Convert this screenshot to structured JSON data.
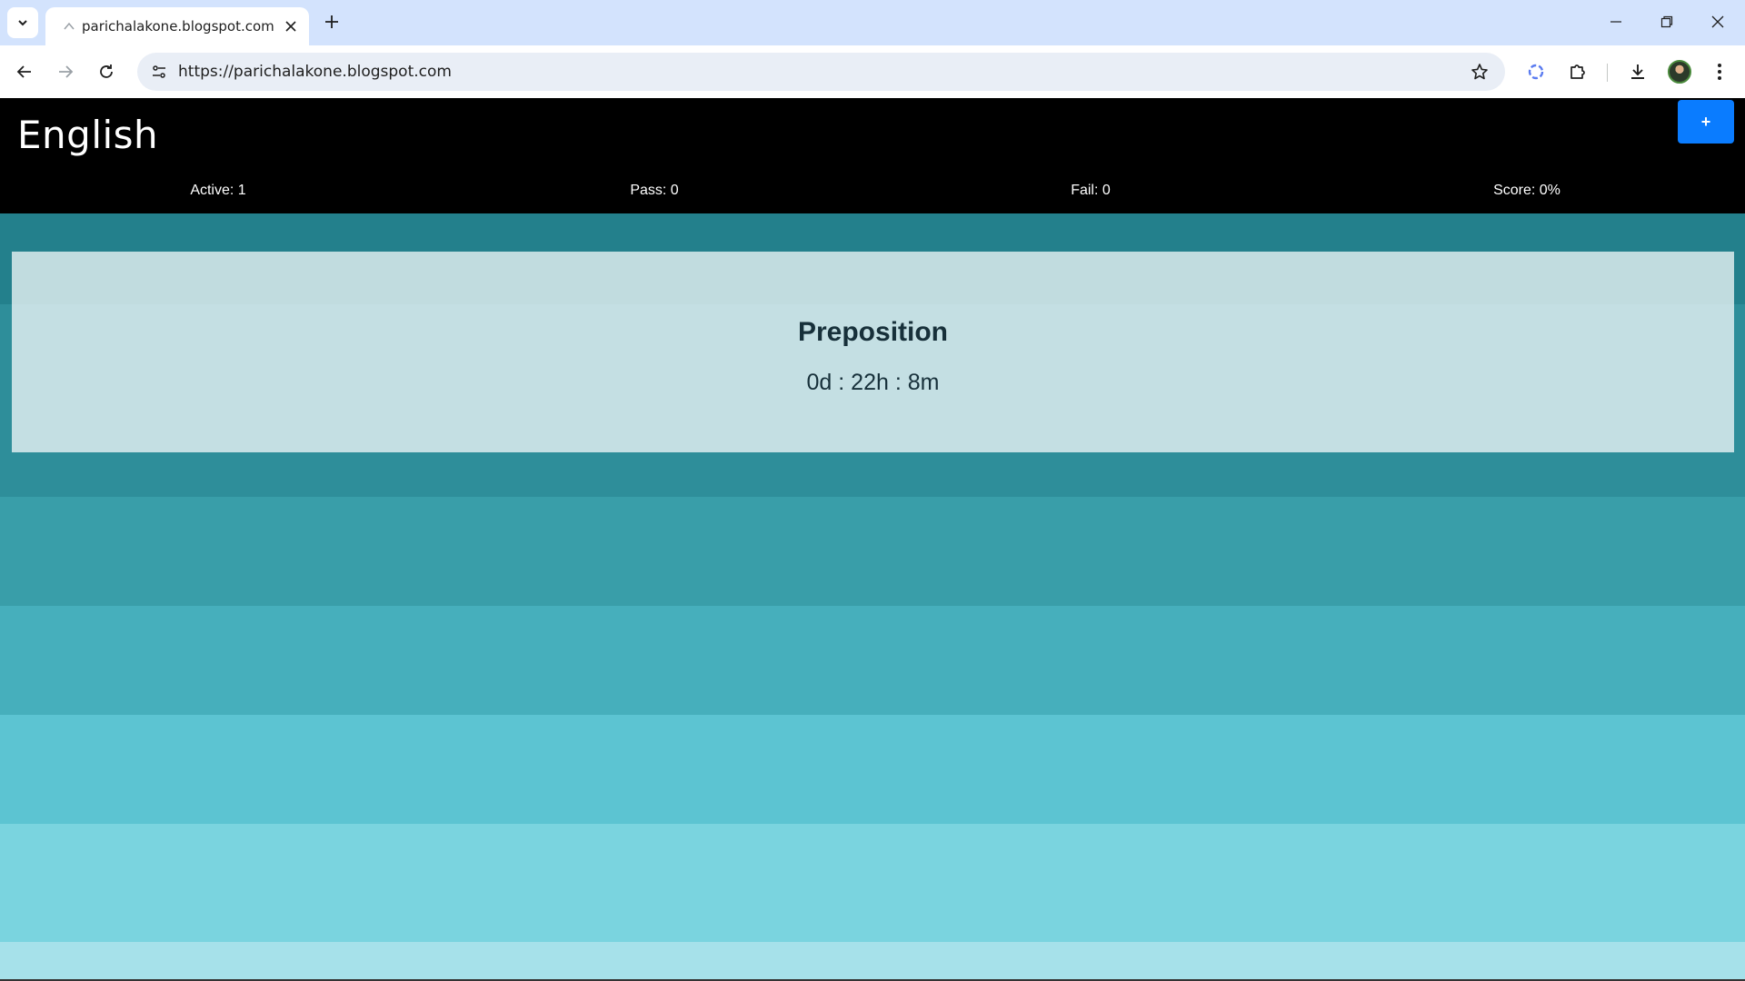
{
  "browser": {
    "tab_title": "parichalakone.blogspot.com",
    "url": "https://parichalakone.blogspot.com"
  },
  "header": {
    "title": "English",
    "add_label": "+"
  },
  "stats": {
    "active": "Active: 1",
    "pass": "Pass: 0",
    "fail": "Fail: 0",
    "score": "Score: 0%"
  },
  "card": {
    "title": "Preposition",
    "timer": "0d : 22h : 8m"
  },
  "colors": {
    "header_bg": "#000000",
    "add_button": "#0a7cff",
    "bands": [
      "#23808c",
      "#2e8e9a",
      "#399ea9",
      "#46afbc",
      "#5cc4d2",
      "#7ad4df",
      "#a6e1ea"
    ]
  },
  "icons": [
    "tab-list-icon",
    "favicon-icon",
    "close-icon",
    "plus-icon",
    "minimize-icon",
    "restore-icon",
    "window-close-icon",
    "back-icon",
    "forward-icon",
    "reload-icon",
    "site-info-icon",
    "star-icon",
    "ai-icon",
    "extensions-icon",
    "download-icon",
    "more-icon"
  ]
}
